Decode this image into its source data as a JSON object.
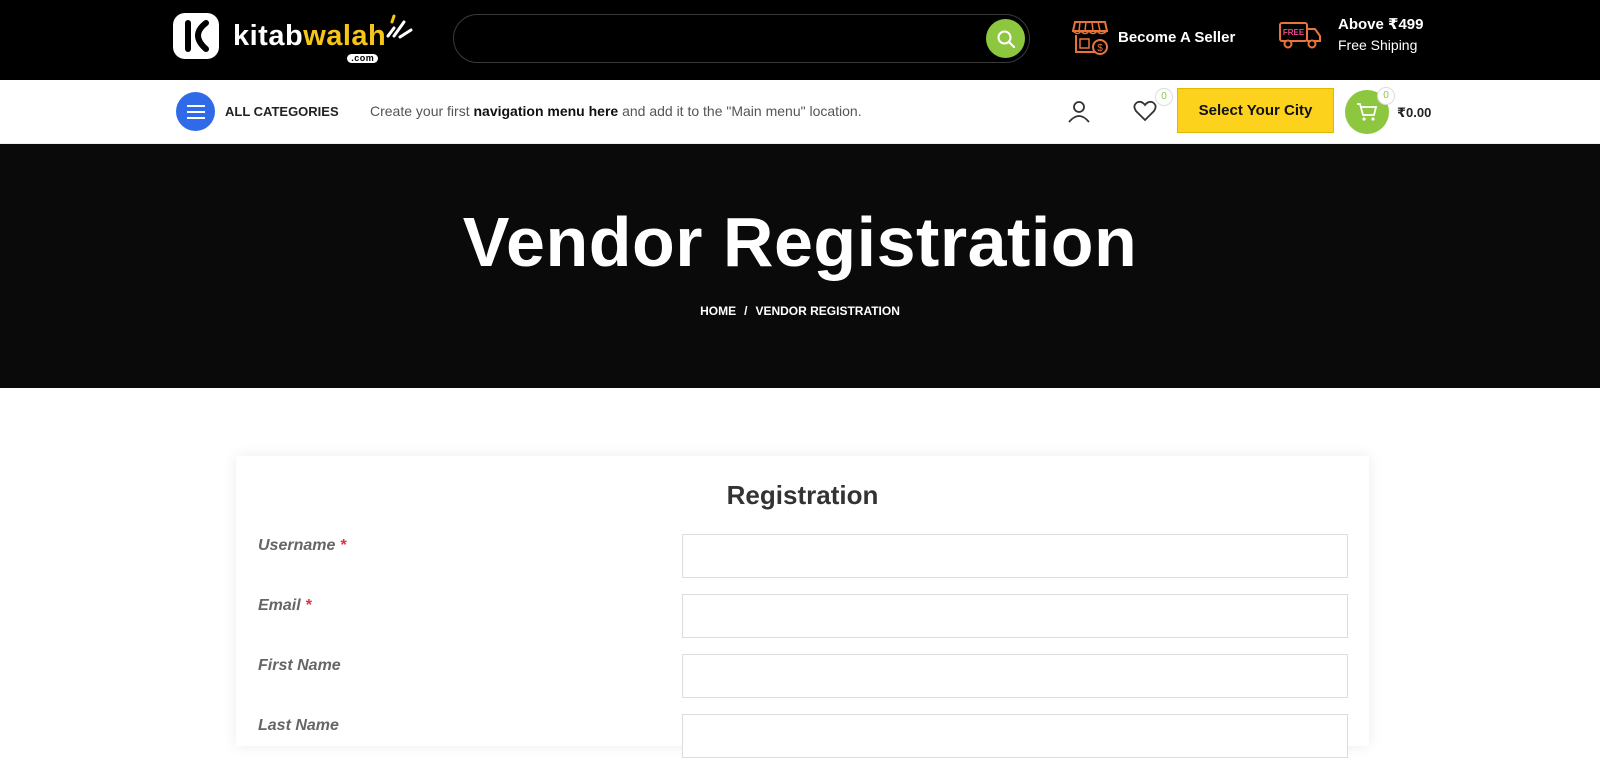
{
  "header": {
    "logo": {
      "part1": "kitab",
      "part2": "walah",
      "suffix": ".com"
    },
    "search": {
      "placeholder": "",
      "value": ""
    },
    "seller_link": "Become A Seller",
    "shipping": {
      "title": "Above ₹499",
      "subtitle": "Free Shiping"
    },
    "icons": {
      "search": "search-icon",
      "seller": "store-icon",
      "shipping": "free-truck-icon"
    },
    "colors": {
      "accent_green": "#8dc63f",
      "accent_yellow": "#fcd21c",
      "accent_blue": "#2f6be8"
    }
  },
  "navbar": {
    "categories_label": "ALL CATEGORIES",
    "menu_message": {
      "before": "Create your first ",
      "link": "navigation menu here",
      "after": " and add it to the \"Main menu\" location."
    },
    "wishlist_count": "0",
    "city_button": "Select Your City",
    "cart_count": "0",
    "cart_total": "₹0.00"
  },
  "hero": {
    "title": "Vendor Registration",
    "breadcrumb": {
      "home": "HOME",
      "separator": "/",
      "current": "VENDOR REGISTRATION"
    }
  },
  "form": {
    "title": "Registration",
    "fields": [
      {
        "label": "Username",
        "required_mark": "*",
        "value": ""
      },
      {
        "label": "Email",
        "required_mark": "*",
        "value": ""
      },
      {
        "label": "First Name",
        "required_mark": "",
        "value": ""
      },
      {
        "label": "Last Name",
        "required_mark": "",
        "value": ""
      }
    ]
  }
}
